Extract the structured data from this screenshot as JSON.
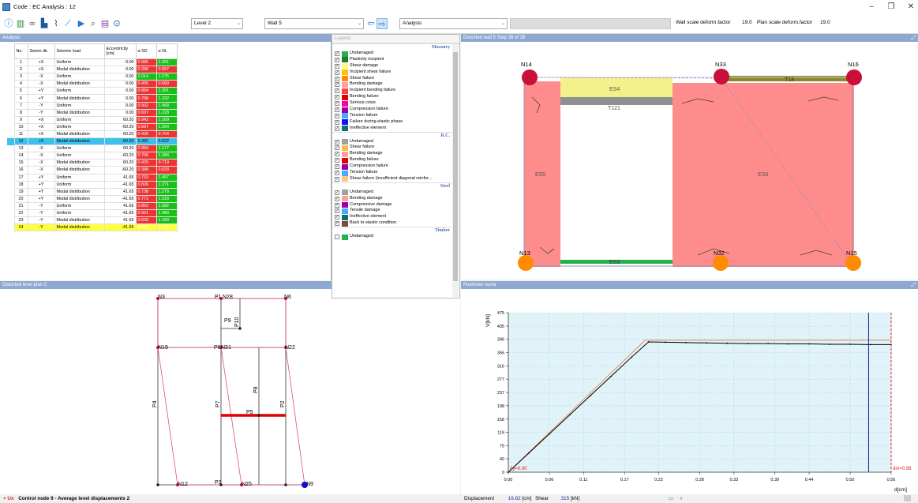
{
  "window": {
    "title": "Code : EC  Analysis : 12",
    "controls": [
      "–",
      "❐",
      "✕"
    ]
  },
  "toolbar": {
    "icons": [
      "info-icon",
      "chart-icon",
      "link-icon",
      "building-icon",
      "chart-edit-icon",
      "pushover-icon",
      "play-icon",
      "search-chart-icon",
      "layers-icon",
      "binoculars-icon"
    ],
    "level_select": "Level 2",
    "wall_select": "Wall 5",
    "prev_label": "⇦",
    "next_label": "⇨",
    "mode_select": "Analysis",
    "wall_scale_label": "Wall scale deform.factor",
    "wall_scale_value": "19.0",
    "plan_scale_label": "Plan scale deform.factor",
    "plan_scale_value": "19.0"
  },
  "analysis": {
    "header": "Analysis",
    "columns": [
      "No.",
      "Seism dir.",
      "Seismic load",
      "Eccentricity [cm]",
      "α SD",
      "α DL"
    ],
    "rows": [
      {
        "no": "1",
        "dir": "+X",
        "load": "Uniform",
        "ecc": "0.00",
        "sd": "0.985",
        "dl": "1.261",
        "sdc": "red",
        "dlc": "green"
      },
      {
        "no": "2",
        "dir": "+X",
        "load": "Modal distribution",
        "ecc": "0.00",
        "sd": "0.396",
        "dl": "0.657",
        "sdc": "red",
        "dlc": "red"
      },
      {
        "no": "3",
        "dir": "-X",
        "load": "Uniform",
        "ecc": "0.00",
        "sd": "1.014",
        "dl": "1.275",
        "sdc": "green",
        "dlc": "green"
      },
      {
        "no": "4",
        "dir": "-X",
        "load": "Modal distribution",
        "ecc": "0.00",
        "sd": "0.405",
        "dl": "0.669",
        "sdc": "red",
        "dlc": "red"
      },
      {
        "no": "5",
        "dir": "+Y",
        "load": "Uniform",
        "ecc": "0.00",
        "sd": "0.884",
        "dl": "1.391",
        "sdc": "red",
        "dlc": "green"
      },
      {
        "no": "6",
        "dir": "+Y",
        "load": "Modal distribution",
        "ecc": "0.00",
        "sd": "0.798",
        "dl": "1.332",
        "sdc": "red",
        "dlc": "green"
      },
      {
        "no": "7",
        "dir": "-Y",
        "load": "Uniform",
        "ecc": "0.00",
        "sd": "0.902",
        "dl": "1.468",
        "sdc": "red",
        "dlc": "green"
      },
      {
        "no": "8",
        "dir": "-Y",
        "load": "Modal distribution",
        "ecc": "0.00",
        "sd": "0.697",
        "dl": "1.228",
        "sdc": "red",
        "dlc": "green"
      },
      {
        "no": "9",
        "dir": "+X",
        "load": "Uniform",
        "ecc": "60.20",
        "sd": "0.942",
        "dl": "1.169",
        "sdc": "red",
        "dlc": "green"
      },
      {
        "no": "10",
        "dir": "+X",
        "load": "Uniform",
        "ecc": "-60.20",
        "sd": "0.687",
        "dl": "1.254",
        "sdc": "red",
        "dlc": "green"
      },
      {
        "no": "11",
        "dir": "+X",
        "load": "Modal distribution",
        "ecc": "60.20",
        "sd": "0.420",
        "dl": "0.704",
        "sdc": "red",
        "dlc": "red"
      },
      {
        "no": "12",
        "dir": "+X",
        "load": "Modal distribution",
        "ecc": "-60.20",
        "sd": "0.382",
        "dl": "0.622",
        "sdc": "sel",
        "dlc": "sel"
      },
      {
        "no": "13",
        "dir": "-X",
        "load": "Uniform",
        "ecc": "60.20",
        "sd": "0.984",
        "dl": "1.177",
        "sdc": "red",
        "dlc": "green"
      },
      {
        "no": "14",
        "dir": "-X",
        "load": "Uniform",
        "ecc": "-60.20",
        "sd": "0.706",
        "dl": "1.284",
        "sdc": "red",
        "dlc": "green"
      },
      {
        "no": "15",
        "dir": "-X",
        "load": "Modal distribution",
        "ecc": "60.20",
        "sd": "0.429",
        "dl": "0.719",
        "sdc": "red",
        "dlc": "red"
      },
      {
        "no": "16",
        "dir": "-X",
        "load": "Modal distribution",
        "ecc": "-60.20",
        "sd": "0.388",
        "dl": "0.633",
        "sdc": "red",
        "dlc": "red"
      },
      {
        "no": "17",
        "dir": "+Y",
        "load": "Uniform",
        "ecc": "41.65",
        "sd": "0.793",
        "dl": "1.457",
        "sdc": "red",
        "dlc": "green"
      },
      {
        "no": "18",
        "dir": "+Y",
        "load": "Uniform",
        "ecc": "-41.65",
        "sd": "0.826",
        "dl": "1.371",
        "sdc": "red",
        "dlc": "green"
      },
      {
        "no": "19",
        "dir": "+Y",
        "load": "Modal distribution",
        "ecc": "41.65",
        "sd": "0.738",
        "dl": "1.278",
        "sdc": "red",
        "dlc": "green"
      },
      {
        "no": "20",
        "dir": "+Y",
        "load": "Modal distribution",
        "ecc": "-41.65",
        "sd": "0.771",
        "dl": "1.316",
        "sdc": "red",
        "dlc": "green"
      },
      {
        "no": "21",
        "dir": "-Y",
        "load": "Uniform",
        "ecc": "41.65",
        "sd": "0.862",
        "dl": "1.582",
        "sdc": "red",
        "dlc": "green"
      },
      {
        "no": "22",
        "dir": "-Y",
        "load": "Uniform",
        "ecc": "-41.65",
        "sd": "0.921",
        "dl": "1.480",
        "sdc": "red",
        "dlc": "green"
      },
      {
        "no": "23",
        "dir": "-Y",
        "load": "Modal distribution",
        "ecc": "41.65",
        "sd": "0.639",
        "dl": "1.180",
        "sdc": "red",
        "dlc": "green"
      },
      {
        "no": "24",
        "dir": "-Y",
        "load": "Modal distribution",
        "ecc": "-41.65",
        "sd": "0.384",
        "dl": "1.122",
        "sdc": "red",
        "dlc": "green",
        "highlight": "yellow"
      }
    ]
  },
  "legend": {
    "title": "Legend",
    "groups": [
      {
        "name": "Masonry",
        "items": [
          {
            "label": "Undamaged",
            "color": "#22b14c",
            "checked": true
          },
          {
            "label": "Plasticity incipient",
            "color": "#1f7a3d",
            "checked": true
          },
          {
            "label": "Shear damage",
            "color": "#fff98c",
            "checked": true
          },
          {
            "label": "Incipient shear failure",
            "color": "#ffc000",
            "checked": true
          },
          {
            "label": "Shear failure",
            "color": "#ff8c00",
            "checked": true
          },
          {
            "label": "Bending damage",
            "color": "#ff9ea0",
            "checked": true
          },
          {
            "label": "Incipient bending failure",
            "color": "#ff4040",
            "checked": true
          },
          {
            "label": "Bending failure",
            "color": "#e00000",
            "checked": true
          },
          {
            "label": "Serious crisis",
            "color": "#ff00a8",
            "checked": true
          },
          {
            "label": "Compression failure",
            "color": "#9b00a8",
            "checked": true
          },
          {
            "label": "Tension failure",
            "color": "#4aa8ff",
            "checked": true
          },
          {
            "label": "Failure during elastic phase",
            "color": "#1010ff",
            "checked": true
          },
          {
            "label": "Ineffective element",
            "color": "#0f6e6e",
            "checked": true
          }
        ]
      },
      {
        "name": "R.C.",
        "items": [
          {
            "label": "Undamaged",
            "color": "#a0a0a0",
            "checked": true
          },
          {
            "label": "Shear failure",
            "color": "#ffb84a",
            "checked": true
          },
          {
            "label": "Bending damage",
            "color": "#ff9ea0",
            "checked": true
          },
          {
            "label": "Bending failure",
            "color": "#e00000",
            "checked": true
          },
          {
            "label": "Compression failure",
            "color": "#9b00a8",
            "checked": true
          },
          {
            "label": "Tension failure",
            "color": "#4aa8ff",
            "checked": true
          },
          {
            "label": "Shear failure (insufficient diagonal reinfor...",
            "color": "#ffc880",
            "checked": true
          }
        ]
      },
      {
        "name": "Steel",
        "items": [
          {
            "label": "Undamaged",
            "color": "#a0a0a0",
            "checked": true
          },
          {
            "label": "Bending damage",
            "color": "#ff9ea0",
            "checked": true
          },
          {
            "label": "Compressive damage",
            "color": "#9b00a8",
            "checked": true
          },
          {
            "label": "Tensile damage",
            "color": "#4aa8ff",
            "checked": true
          },
          {
            "label": "Ineffective element",
            "color": "#0f6e6e",
            "checked": true
          },
          {
            "label": "Back to elastic condition",
            "color": "#7a4a3a",
            "checked": true
          }
        ]
      },
      {
        "name": "Timber",
        "items": [
          {
            "label": "Undamaged",
            "color": "#22b14c",
            "checked": false
          }
        ]
      }
    ]
  },
  "wall_view": {
    "header": "Distorted wall 5 Step 39 of 39",
    "nodes": [
      "N14",
      "N33",
      "N16",
      "N13",
      "N32",
      "N15"
    ],
    "elements": [
      "ES4",
      "T121",
      "T18",
      "ES5",
      "ES6",
      "ES3"
    ]
  },
  "level_plan": {
    "header": "Distorted level plan 2",
    "nodes": [
      "N3",
      "P1",
      "N28",
      "N6",
      "N19",
      "P6",
      "N31",
      "N22",
      "N12",
      "P3",
      "N25",
      "N9"
    ],
    "walls": [
      "P10",
      "P9",
      "P8",
      "P4",
      "P7",
      "P2",
      "P5"
    ]
  },
  "pushover": {
    "header": "Pushover curve",
    "dy_label": "dy=0.00",
    "dm_label": "dm=0.56"
  },
  "chart_data": {
    "type": "line",
    "title": "Pushover curve",
    "xlabel": "d[cm]",
    "ylabel": "V[kN]",
    "xlim": [
      0,
      0.56
    ],
    "ylim": [
      0,
      475
    ],
    "x_ticks": [
      "0.00",
      "0.06",
      "0.11",
      "0.17",
      "0.22",
      "0.28",
      "0.33",
      "0.39",
      "0.44",
      "0.50",
      "0.56"
    ],
    "y_ticks": [
      "0",
      "40",
      "79",
      "119",
      "158",
      "198",
      "237",
      "277",
      "316",
      "356",
      "396",
      "435",
      "475"
    ],
    "series": [
      {
        "color": "#000000",
        "x": [
          0.0,
          0.03,
          0.06,
          0.09,
          0.12,
          0.15,
          0.18,
          0.205,
          0.23,
          0.26,
          0.29,
          0.32,
          0.35,
          0.38,
          0.41,
          0.44,
          0.47,
          0.5,
          0.53,
          0.56
        ],
        "y": [
          0,
          57,
          114,
          171,
          228,
          285,
          342,
          388,
          387,
          386,
          385,
          384,
          383,
          383,
          382,
          382,
          381,
          381,
          380,
          380
        ]
      },
      {
        "color": "#f08060",
        "x": [
          0.0,
          0.2,
          0.56
        ],
        "y": [
          0,
          393,
          393
        ]
      }
    ],
    "vlines": [
      {
        "x": 0.527,
        "color": "#1a1a90"
      },
      {
        "x": 0.56,
        "color": "#e02020"
      }
    ]
  },
  "status": {
    "left_prefix": "+ Ux",
    "left_text": "Control node 9 - Average level displacements 2",
    "disp_label": "Displacement",
    "disp_value": "16.82",
    "disp_unit": "[cm]",
    "shear_label": "Shear",
    "shear_value": "315",
    "shear_unit": "[kN]"
  }
}
